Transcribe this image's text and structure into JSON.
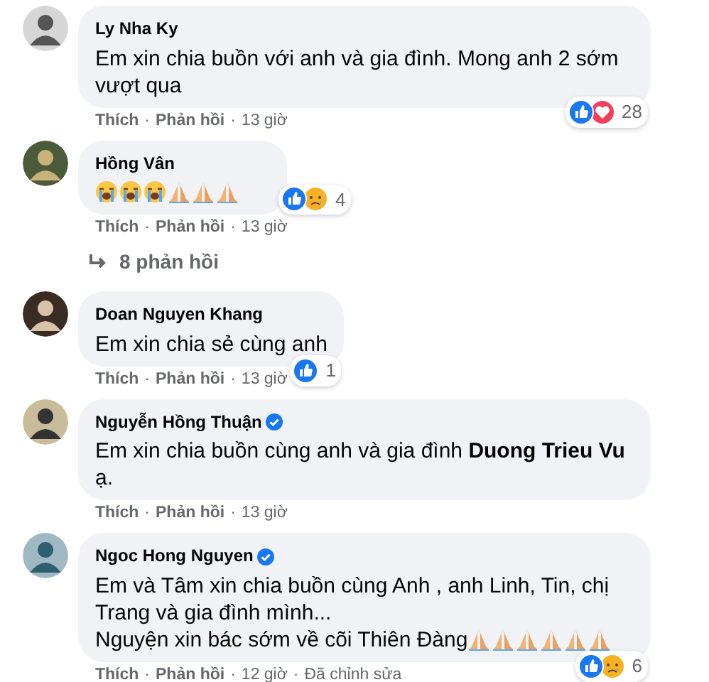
{
  "separator": "·",
  "comments": [
    {
      "author": "Ly Nha Ky",
      "verified": false,
      "lines": [
        {
          "text": "Em xin chia buồn với anh và gia đình. Mong anh 2 sớm vượt qua"
        }
      ],
      "reactions": [
        {
          "kind": "like"
        },
        {
          "kind": "love"
        }
      ],
      "reaction_count": "28",
      "actions": [
        "Thích",
        "Phản hồi"
      ],
      "time": "13 giờ"
    },
    {
      "author": "Hồng Vân",
      "verified": false,
      "lines": [
        {
          "emojis": [
            {
              "kind": "crying"
            },
            {
              "kind": "crying"
            },
            {
              "kind": "crying"
            },
            {
              "kind": "pray"
            },
            {
              "kind": "pray"
            },
            {
              "kind": "pray"
            }
          ]
        }
      ],
      "reactions": [
        {
          "kind": "like"
        },
        {
          "kind": "sad"
        }
      ],
      "reaction_count": "4",
      "actions": [
        "Thích",
        "Phản hồi"
      ],
      "time": "13 giờ",
      "replies_link": "8 phản hồi"
    },
    {
      "author": "Doan Nguyen Khang",
      "verified": false,
      "lines": [
        {
          "text": "Em xin chia sẻ cùng anh"
        }
      ],
      "reactions": [
        {
          "kind": "like"
        }
      ],
      "reaction_count": "1",
      "actions": [
        "Thích",
        "Phản hồi"
      ],
      "time": "13 giờ"
    },
    {
      "author": "Nguyễn Hồng Thuận",
      "verified": true,
      "lines": [
        {
          "text": "Em xin chia buồn cùng anh và gia đình **Duong Trieu Vu** ạ."
        }
      ],
      "actions": [
        "Thích",
        "Phản hồi"
      ],
      "time": "13 giờ"
    },
    {
      "author": "Ngoc Hong Nguyen",
      "verified": true,
      "lines": [
        {
          "text": "Em và Tâm xin chia buồn cùng Anh , anh Linh, Tin, chị Trang và gia đình mình..."
        },
        {
          "text": "Nguyện xin bác sớm về cõi Thiên Đàng",
          "emojis": [
            {
              "kind": "pray"
            },
            {
              "kind": "pray"
            },
            {
              "kind": "pray"
            },
            {
              "kind": "pray"
            },
            {
              "kind": "pray"
            },
            {
              "kind": "pray"
            }
          ]
        }
      ],
      "reactions": [
        {
          "kind": "like"
        },
        {
          "kind": "sad"
        }
      ],
      "reaction_count": "6",
      "actions": [
        "Thích",
        "Phản hồi"
      ],
      "time": "12 giờ",
      "edited": "Đã chỉnh sửa"
    }
  ]
}
